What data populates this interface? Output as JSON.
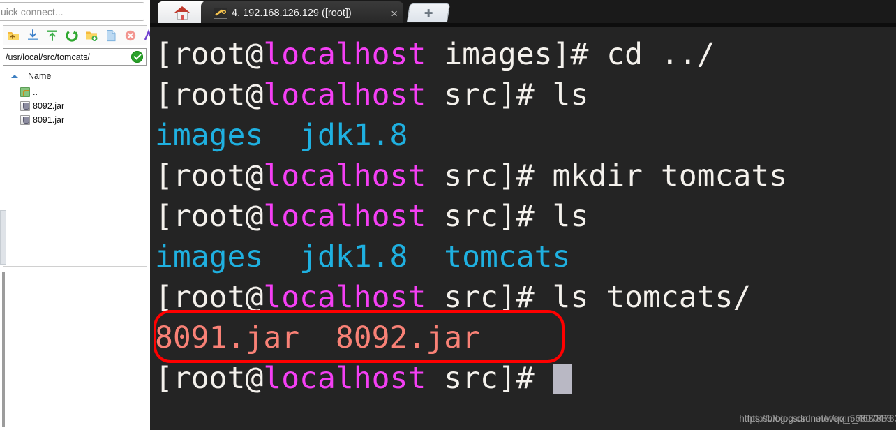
{
  "colors": {
    "terminal_bg": "#242424",
    "prompt_white": "#f4f1ec",
    "host_magenta": "#f43ff4",
    "dir_cyan": "#1fb0e0",
    "archive_salmon": "#f98176",
    "highlight_red": "#ff0000",
    "cursor": "#b9b8c4",
    "tabbar_bg": "#1a1a1a"
  },
  "sidebar": {
    "quick_connect": {
      "placeholder": "uick connect...",
      "value": "uick connect..."
    },
    "toolbar_icons": [
      {
        "name": "up-directory-icon",
        "label": "Up one directory"
      },
      {
        "name": "download-icon",
        "label": "Download"
      },
      {
        "name": "upload-icon",
        "label": "Upload"
      },
      {
        "name": "refresh-icon",
        "label": "Refresh"
      },
      {
        "name": "new-folder-icon",
        "label": "New folder"
      },
      {
        "name": "new-file-icon",
        "label": "New file"
      },
      {
        "name": "delete-icon",
        "label": "Delete"
      },
      {
        "name": "rename-icon",
        "label": "Rename"
      }
    ],
    "path_bar": {
      "path": "/usr/local/src/tomcats/",
      "status_icon": "check-circle-icon"
    },
    "file_list": {
      "column_header": "Name",
      "sort_direction": "asc",
      "rows": [
        {
          "name": "..",
          "icon": "up-directory-icon"
        },
        {
          "name": "8092.jar",
          "icon": "java-jar-icon"
        },
        {
          "name": "8091.jar",
          "icon": "java-jar-icon"
        }
      ]
    }
  },
  "tabbar": {
    "home_tab": {
      "label": "",
      "icon": "home-icon"
    },
    "session_tab": {
      "title": "4. 192.168.126.129 ([root])",
      "icon": "key-icon",
      "close_label": "×"
    },
    "new_tab": {
      "label": "✚",
      "icon": "plus-icon"
    }
  },
  "terminal": {
    "lines": [
      {
        "segments": [
          {
            "text": "[root@",
            "color": "white"
          },
          {
            "text": "localhost",
            "color": "magenta"
          },
          {
            "text": " images]# cd ../",
            "color": "white"
          }
        ]
      },
      {
        "segments": [
          {
            "text": "[root@",
            "color": "white"
          },
          {
            "text": "localhost",
            "color": "magenta"
          },
          {
            "text": " src]# ls",
            "color": "white"
          }
        ]
      },
      {
        "segments": [
          {
            "text": "images  jdk1.8",
            "color": "cyan"
          }
        ]
      },
      {
        "segments": [
          {
            "text": "[root@",
            "color": "white"
          },
          {
            "text": "localhost",
            "color": "magenta"
          },
          {
            "text": " src]# mkdir tomcats",
            "color": "white"
          }
        ]
      },
      {
        "segments": [
          {
            "text": "[root@",
            "color": "white"
          },
          {
            "text": "localhost",
            "color": "magenta"
          },
          {
            "text": " src]# ls",
            "color": "white"
          }
        ]
      },
      {
        "segments": [
          {
            "text": "images  jdk1.8  tomcats",
            "color": "cyan"
          }
        ]
      },
      {
        "segments": [
          {
            "text": "[root@",
            "color": "white"
          },
          {
            "text": "localhost",
            "color": "magenta"
          },
          {
            "text": " src]# ls tomcats/",
            "color": "white"
          }
        ]
      },
      {
        "segments": [
          {
            "text": "8091.jar  8092.jar",
            "color": "salmon"
          }
        ]
      },
      {
        "segments": [
          {
            "text": "[root@",
            "color": "white"
          },
          {
            "text": "localhost",
            "color": "magenta"
          },
          {
            "text": " src]# ",
            "color": "white"
          },
          {
            "text": "",
            "color": "cursor"
          }
        ]
      }
    ],
    "highlight_note": "red rounded rectangle around the 8091.jar 8092.jar output line",
    "watermark_a": "https://blog.csdn.net/qq_56807883",
    "watermark_b": "https://blog.csdn.net/weixin_46804783"
  }
}
